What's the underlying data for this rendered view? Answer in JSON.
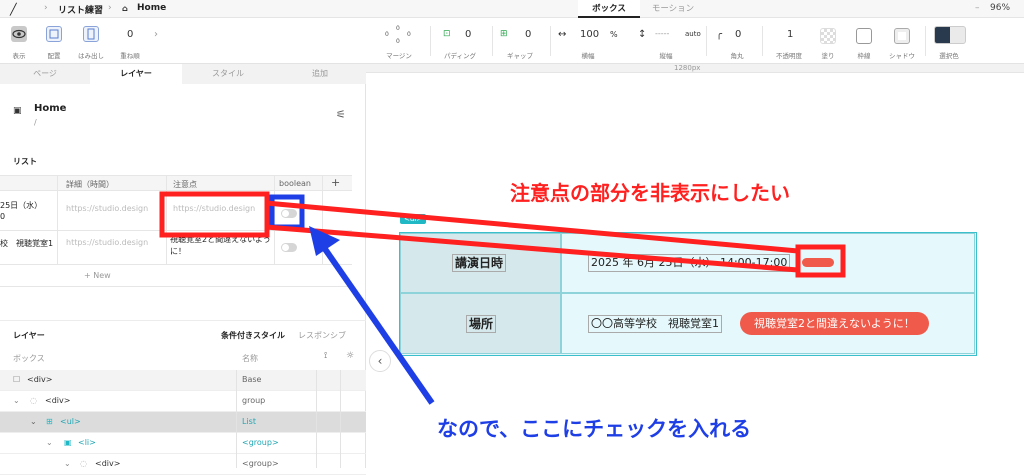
{
  "topbar": {
    "breadcrumb_project": "リスト練習",
    "page_name": "Home",
    "tabs": [
      "ボックス",
      "モーション"
    ],
    "zoom": "96%"
  },
  "toolbar": {
    "items": [
      {
        "label": "表示"
      },
      {
        "label": "配置"
      },
      {
        "label": "はみ出し"
      },
      {
        "label": "重ね順",
        "value": "0"
      }
    ],
    "margin": {
      "label": "マージン",
      "top": "0",
      "left": "0",
      "right": "0",
      "bottom": "0"
    },
    "padding": {
      "label": "パディング",
      "value": "0"
    },
    "gap": {
      "label": "ギャップ",
      "value": "0"
    },
    "width": {
      "label": "横幅",
      "value": "100",
      "unit": "%"
    },
    "height": {
      "label": "縦幅",
      "value": "-----",
      "unit": "auto"
    },
    "radius": {
      "label": "角丸",
      "value": "0"
    },
    "opacity": {
      "label": "不透明度",
      "value": "1"
    },
    "fill": {
      "label": "塗り"
    },
    "border": {
      "label": "枠線"
    },
    "shadow": {
      "label": "シャドウ"
    },
    "selection": {
      "label": "選択色"
    }
  },
  "leftpanel": {
    "tabs": [
      "ページ",
      "レイヤー",
      "スタイル",
      "追加"
    ],
    "page_title": "Home",
    "page_path": "/",
    "list_title": "リスト",
    "grid": {
      "columns": [
        "詳細（時間）",
        "注意点",
        "boolean"
      ],
      "add_col": "+",
      "rows": [
        {
          "first": "25日（水）",
          "first2": "0",
          "detail": "https://studio.design",
          "note": "https://studio.design"
        },
        {
          "first": "校　視聴覚室1",
          "detail": "https://studio.design",
          "note": "視聴覚室2と間違えないように！"
        }
      ],
      "new_row": "+ New"
    },
    "layers": {
      "title": "レイヤー",
      "conditional": "条件付きスタイル",
      "responsive": "レスポンシブ",
      "col_box": "ボックス",
      "col_name": "名称",
      "rows": [
        {
          "tag": "<div>",
          "name": "Base"
        },
        {
          "tag": "<div>",
          "name": "group"
        },
        {
          "tag": "<ul>",
          "name": "List"
        },
        {
          "tag": "<li>",
          "name": "<group>"
        },
        {
          "tag": "<div>",
          "name": "<group>"
        }
      ]
    }
  },
  "canvas": {
    "ruler_label": "1280px",
    "ul_tag": "<ul>",
    "row1": {
      "label": "講演日時",
      "value": "2025 年 6月 25日（水） 14:00-17:00"
    },
    "row2": {
      "label": "場所",
      "value": "〇〇高等学校　視聴覚室1",
      "badge": "視聴覚室2と間違えないように！"
    }
  },
  "annotations": {
    "red": "注意点の部分を非表示にしたい",
    "blue": "なので、ここにチェックを入れる"
  },
  "colors": {
    "red": "#ff2020",
    "blue": "#1f3fe6",
    "teal": "#1fb8c4",
    "badge": "#ef5a4a"
  }
}
